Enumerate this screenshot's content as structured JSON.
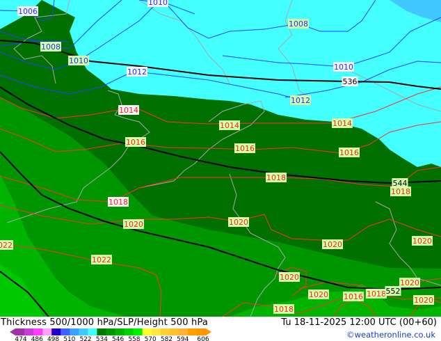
{
  "map": {
    "colors": {
      "cyan_region": "#44ffff",
      "light_blue_region": "#40c8ff",
      "dark_green_region": "#007000",
      "mid_green_region": "#009600",
      "green_region": "#00b400",
      "bright_green_region": "#00c800",
      "isobar_low": "#2040ff",
      "isobar_high": "#ff3030",
      "thickness_line": "#000000",
      "coastline": "#a8a8a8"
    },
    "labels": [
      {
        "text": "1006",
        "kind": "low",
        "bg": "white"
      },
      {
        "text": "1008",
        "kind": "low",
        "bg": "green"
      },
      {
        "text": "1010",
        "kind": "low",
        "bg": "green"
      },
      {
        "text": "1010",
        "kind": "low",
        "bg": "white"
      },
      {
        "text": "1012",
        "kind": "low",
        "bg": "white"
      },
      {
        "text": "1008",
        "kind": "low",
        "bg": "green"
      },
      {
        "text": "1010",
        "kind": "low",
        "bg": "white"
      },
      {
        "text": "536",
        "kind": "thick",
        "bg": "white"
      },
      {
        "text": "1012",
        "kind": "low",
        "bg": "green"
      },
      {
        "text": "1014",
        "kind": "high",
        "bg": "white"
      },
      {
        "text": "1014",
        "kind": "high",
        "bg": "green"
      },
      {
        "text": "1014",
        "kind": "high",
        "bg": "green"
      },
      {
        "text": "1016",
        "kind": "high",
        "bg": "green"
      },
      {
        "text": "1016",
        "kind": "high",
        "bg": "green"
      },
      {
        "text": "1016",
        "kind": "high",
        "bg": "green"
      },
      {
        "text": "1018",
        "kind": "high",
        "bg": "green"
      },
      {
        "text": "544",
        "kind": "thick",
        "bg": "green"
      },
      {
        "text": "1018",
        "kind": "high",
        "bg": "green"
      },
      {
        "text": "1018",
        "kind": "high",
        "bg": "white"
      },
      {
        "text": "1020",
        "kind": "high",
        "bg": "green"
      },
      {
        "text": "1020",
        "kind": "high",
        "bg": "green"
      },
      {
        "text": "1020",
        "kind": "high",
        "bg": "green"
      },
      {
        "text": "1020",
        "kind": "high",
        "bg": "green"
      },
      {
        "text": "1022",
        "kind": "high",
        "bg": "green"
      },
      {
        "text": "1022",
        "kind": "high",
        "bg": "green"
      },
      {
        "text": "1020",
        "kind": "high",
        "bg": "green"
      },
      {
        "text": "1020",
        "kind": "high",
        "bg": "green"
      },
      {
        "text": "1020",
        "kind": "high",
        "bg": "green"
      },
      {
        "text": "1016",
        "kind": "high",
        "bg": "green"
      },
      {
        "text": "1018",
        "kind": "high",
        "bg": "green"
      },
      {
        "text": "552",
        "kind": "thick",
        "bg": "green"
      },
      {
        "text": "1020",
        "kind": "high",
        "bg": "green"
      },
      {
        "text": "1018",
        "kind": "high",
        "bg": "green"
      }
    ]
  },
  "footer": {
    "title": "Thickness 500/1000 hPa/SLP/Height 500 hPa",
    "valid_time": "Tu 18-11-2025 12:00 UTC (00+60)",
    "credit": "©weatheronline.co.uk",
    "colorbar": {
      "ticks": [
        "474",
        "486",
        "498",
        "510",
        "522",
        "534",
        "546",
        "558",
        "570",
        "582",
        "594",
        "606"
      ],
      "colors": [
        "#a030a8",
        "#c83cd8",
        "#ff3cff",
        "#ffa0ff",
        "#1e00c8",
        "#3c64ff",
        "#3ca0ff",
        "#40c8ff",
        "#40ffff",
        "#007800",
        "#009600",
        "#00b400",
        "#00d200",
        "#00f000",
        "#ffff30",
        "#ffe640",
        "#ffd232",
        "#ffc032",
        "#ffb432",
        "#ffa000",
        "#ff9600"
      ]
    }
  }
}
